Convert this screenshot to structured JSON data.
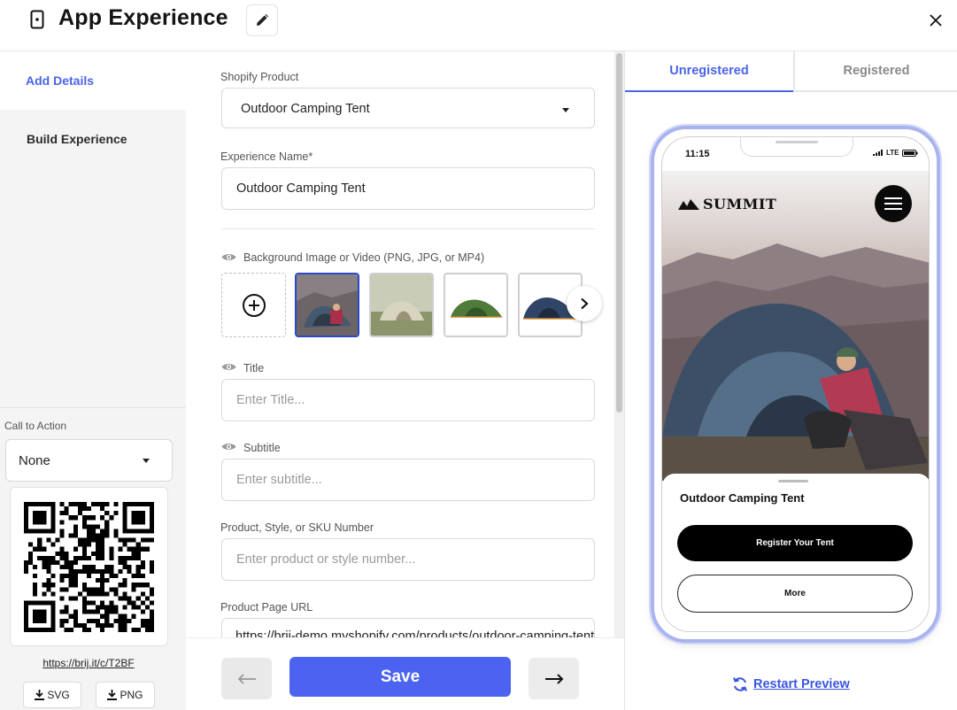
{
  "header": {
    "title": "App Experience",
    "icons": {
      "app": "phone-icon",
      "edit": "pencil-icon",
      "close": "close-icon"
    }
  },
  "sidebar": {
    "items": [
      {
        "label": "Add Details",
        "active": true
      },
      {
        "label": "Build Experience",
        "active": false
      }
    ],
    "cta": {
      "label": "Call to Action",
      "selected": "None"
    },
    "qr": {
      "short_link": "https://brij.it/c/T2BF",
      "download_svg": "SVG",
      "download_png": "PNG"
    }
  },
  "form": {
    "shopify_product": {
      "label": "Shopify Product",
      "value": "Outdoor Camping Tent"
    },
    "experience_name": {
      "label": "Experience Name*",
      "value": "Outdoor Camping Tent"
    },
    "background": {
      "label": "Background Image or Video (PNG, JPG, or MP4)"
    },
    "title": {
      "label": "Title",
      "placeholder": "Enter Title..."
    },
    "subtitle": {
      "label": "Subtitle",
      "placeholder": "Enter subtitle..."
    },
    "sku": {
      "label": "Product, Style, or SKU Number",
      "placeholder": "Enter product or style number..."
    },
    "product_url": {
      "label": "Product Page URL",
      "value": "https://brij-demo.myshopify.com/products/outdoor-camping-tent"
    },
    "save_label": "Save"
  },
  "preview": {
    "tabs": [
      {
        "label": "Unregistered",
        "active": true
      },
      {
        "label": "Registered",
        "active": false
      }
    ],
    "phone": {
      "time": "11:15",
      "network": "LTE",
      "brand": "SUMMIT",
      "sheet_title": "Outdoor Camping Tent",
      "primary_button": "Register Your Tent",
      "secondary_button": "More"
    },
    "restart_label": "Restart Preview"
  },
  "colors": {
    "accent": "#4a64e8",
    "save": "#4b63f0",
    "phone_frame": "#a9b3ee"
  }
}
